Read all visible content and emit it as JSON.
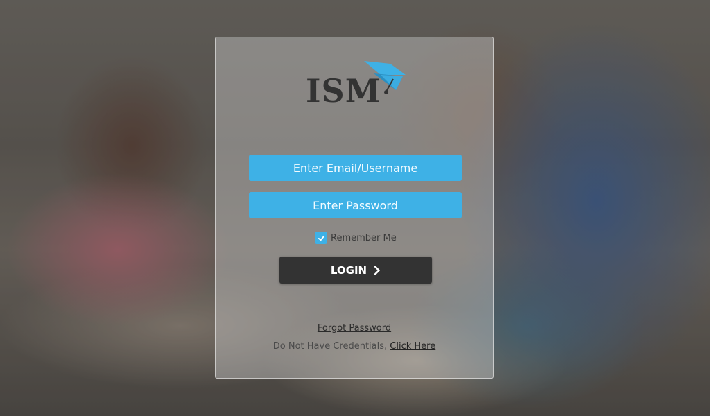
{
  "brand": {
    "logo_text": "ISM",
    "accent_color": "#3eb1e6",
    "dark_color": "#333333"
  },
  "login_form": {
    "email_placeholder": "Enter Email/Username",
    "email_value": "",
    "password_placeholder": "Enter Password",
    "password_value": "",
    "remember_label": "Remember Me",
    "remember_checked": true,
    "login_label": "LOGIN",
    "login_icon": "chevron-right-icon"
  },
  "footer_links": {
    "forgot_password": "Forgot Password",
    "no_credentials_text": "Do Not Have Credentials,",
    "click_here": "Click Here"
  }
}
